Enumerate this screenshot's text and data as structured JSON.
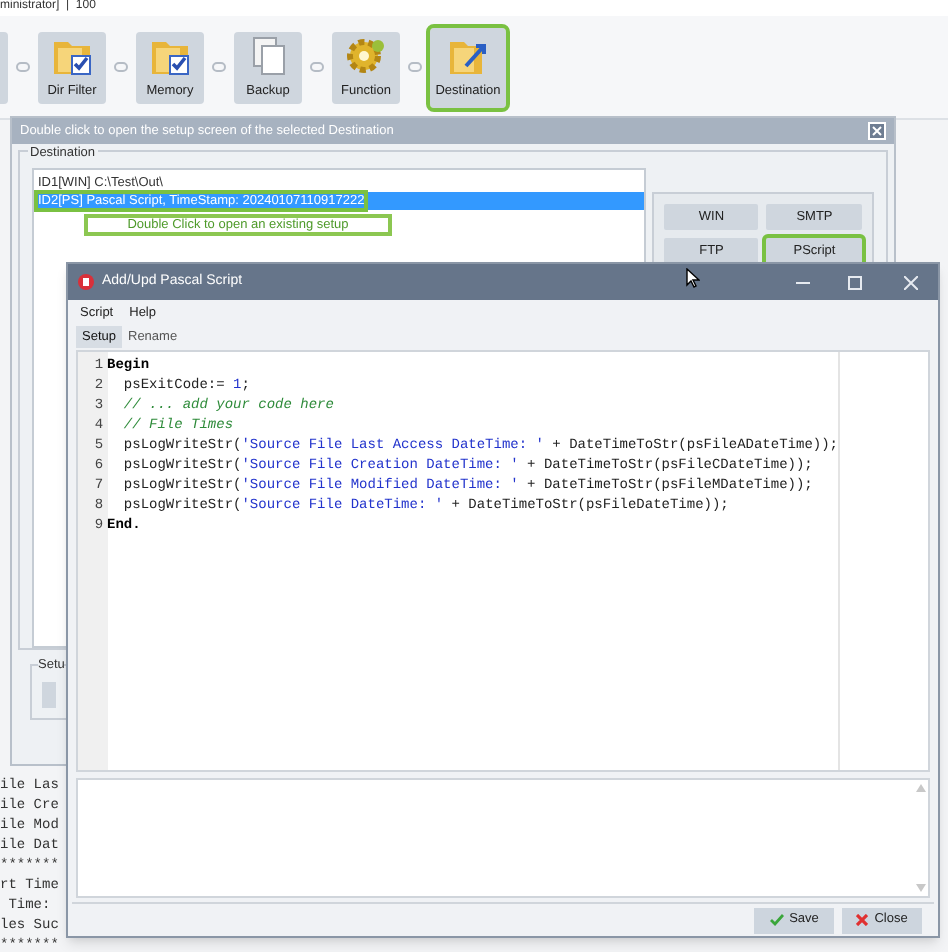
{
  "app": {
    "title": "ministrator]  |  100"
  },
  "toolbar": [
    {
      "label": "Dir Filter",
      "kind": "filter",
      "selected": false
    },
    {
      "label": "Memory",
      "kind": "memory",
      "selected": false
    },
    {
      "label": "Backup",
      "kind": "backup",
      "selected": false
    },
    {
      "label": "Function",
      "kind": "function",
      "selected": false
    },
    {
      "label": "Destination",
      "kind": "destination",
      "selected": true
    }
  ],
  "destination_dialog": {
    "title": "Double click to open the setup screen of the selected Destination",
    "group": "Destination",
    "items": [
      {
        "text": "ID1[WIN] C:\\Test\\Out\\",
        "selected": false
      },
      {
        "text": "ID2[PS] Pascal Script, TimeStamp: 20240107110917222",
        "selected": true
      }
    ],
    "hint": "Double Click to open an existing setup",
    "types": [
      {
        "label": "WIN",
        "selected": false
      },
      {
        "label": "SMTP",
        "selected": false
      },
      {
        "label": "FTP",
        "selected": false
      },
      {
        "label": "PScript",
        "selected": true
      }
    ],
    "setup_group": "Setu"
  },
  "log_lines": [
    "ile Las",
    "ile Cre",
    "ile Mod",
    "ile Dat",
    "*******",
    "rt Time",
    " Time:",
    "les Suc",
    "*******"
  ],
  "script_window": {
    "title": "Add/Upd Pascal Script",
    "menu": [
      "Script",
      "Help"
    ],
    "tabs": [
      {
        "label": "Setup",
        "selected": true
      },
      {
        "label": "Rename",
        "selected": false
      }
    ],
    "code": [
      {
        "number": "1",
        "tokens": [
          {
            "kind": "keyword",
            "text": "Begin"
          }
        ]
      },
      {
        "number": "2",
        "tokens": [
          {
            "kind": "plain",
            "text": "  psExitCode:= "
          },
          {
            "kind": "number",
            "text": "1"
          },
          {
            "kind": "plain",
            "text": ";"
          }
        ]
      },
      {
        "number": "3",
        "tokens": [
          {
            "kind": "comment",
            "text": "  // ... add your code here"
          }
        ]
      },
      {
        "number": "4",
        "tokens": [
          {
            "kind": "comment",
            "text": "  // File Times"
          }
        ]
      },
      {
        "number": "5",
        "tokens": [
          {
            "kind": "plain",
            "text": "  psLogWriteStr("
          },
          {
            "kind": "string",
            "text": "'Source File Last Access DateTime: '"
          },
          {
            "kind": "plain",
            "text": " + DateTimeToStr(psFileADateTime));"
          }
        ]
      },
      {
        "number": "6",
        "tokens": [
          {
            "kind": "plain",
            "text": "  psLogWriteStr("
          },
          {
            "kind": "string",
            "text": "'Source File Creation DateTime: '"
          },
          {
            "kind": "plain",
            "text": " + DateTimeToStr(psFileCDateTime));"
          }
        ]
      },
      {
        "number": "7",
        "tokens": [
          {
            "kind": "plain",
            "text": "  psLogWriteStr("
          },
          {
            "kind": "string",
            "text": "'Source File Modified DateTime: '"
          },
          {
            "kind": "plain",
            "text": " + DateTimeToStr(psFileMDateTime));"
          }
        ]
      },
      {
        "number": "8",
        "tokens": [
          {
            "kind": "plain",
            "text": "  psLogWriteStr("
          },
          {
            "kind": "string",
            "text": "'Source File DateTime: '"
          },
          {
            "kind": "plain",
            "text": " + DateTimeToStr(psFileDateTime));"
          }
        ]
      },
      {
        "number": "9",
        "tokens": [
          {
            "kind": "keyword",
            "text": "End."
          }
        ]
      }
    ],
    "buttons": [
      {
        "label": "Save",
        "kind": "save"
      },
      {
        "label": "Close",
        "kind": "close"
      }
    ]
  }
}
